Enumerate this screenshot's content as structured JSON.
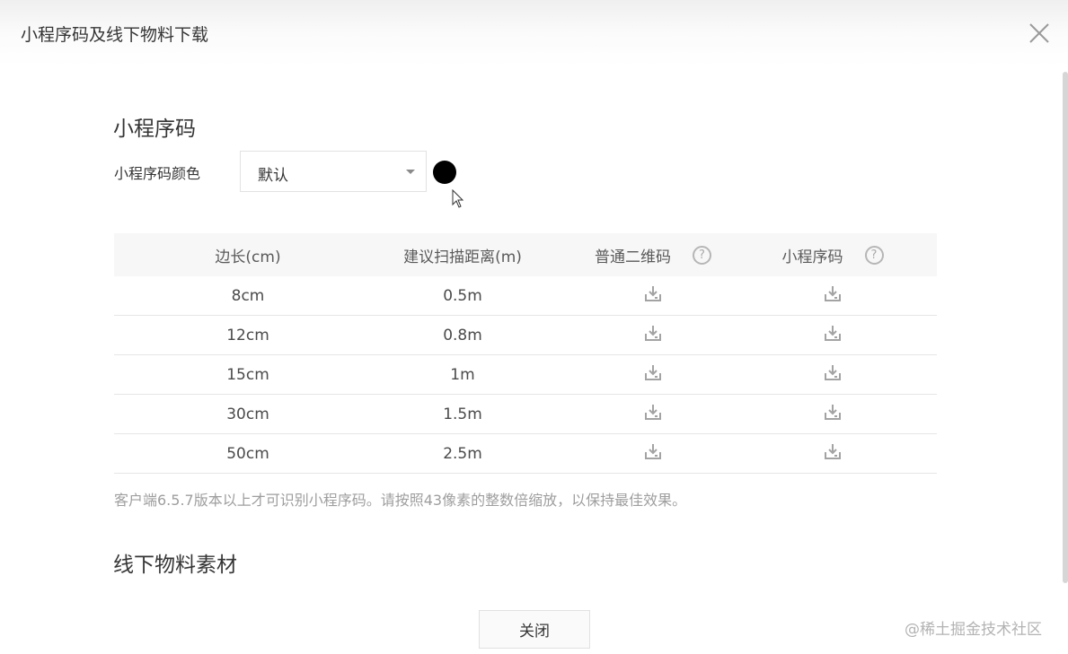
{
  "dialog": {
    "title": "小程序码及线下物料下载"
  },
  "miniapp_section": {
    "title": "小程序码",
    "color_label": "小程序码颜色",
    "color_select_value": "默认",
    "color_swatch": "#000000"
  },
  "table": {
    "headers": [
      "边长(cm)",
      "建议扫描距离(m)",
      "普通二维码",
      "小程序码"
    ],
    "rows": [
      {
        "size": "8cm",
        "distance": "0.5m"
      },
      {
        "size": "12cm",
        "distance": "0.8m"
      },
      {
        "size": "15cm",
        "distance": "1m"
      },
      {
        "size": "30cm",
        "distance": "1.5m"
      },
      {
        "size": "50cm",
        "distance": "2.5m"
      }
    ],
    "help_icon": "question-circle-icon",
    "download_icon": "download-icon"
  },
  "note": "客户端6.5.7版本以上才可识别小程序码。请按照43像素的整数倍缩放，以保持最佳效果。",
  "offline_section": {
    "title": "线下物料素材"
  },
  "footer": {
    "close_label": "关闭"
  },
  "watermark": "@稀土掘金技术社区"
}
